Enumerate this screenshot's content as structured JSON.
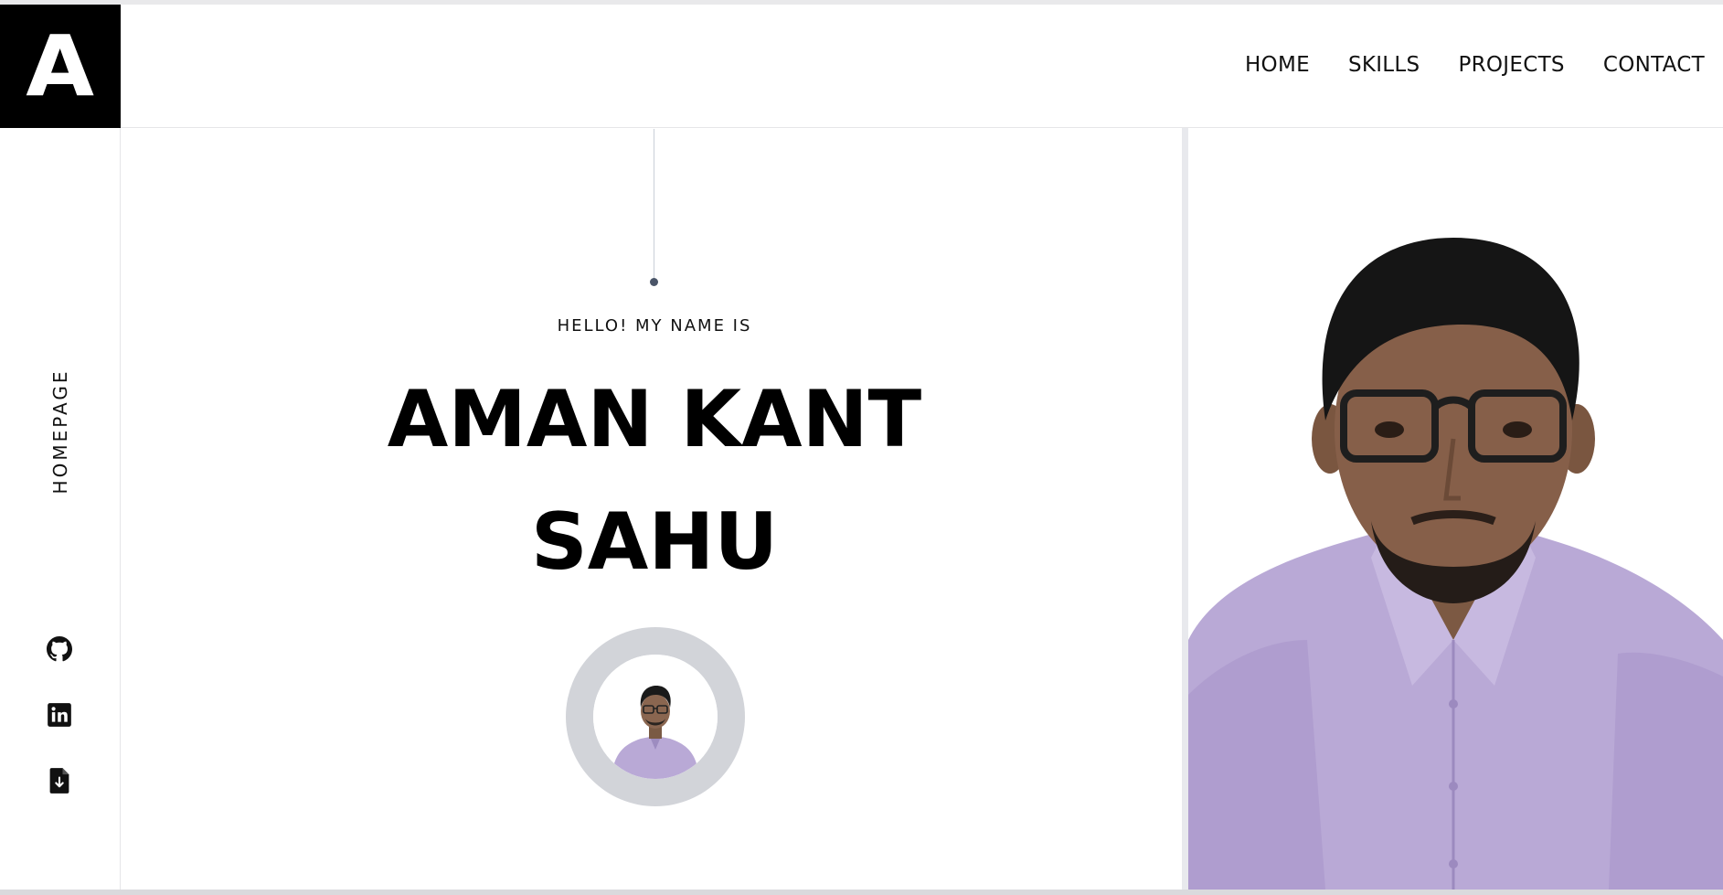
{
  "header": {
    "logo_text": "A",
    "nav": [
      "HOME",
      "SKILLS",
      "PROJECTS",
      "CONTACT"
    ]
  },
  "sidebar": {
    "label": "HOMEPAGE",
    "social": [
      {
        "name": "github",
        "icon": "github-icon"
      },
      {
        "name": "linkedin",
        "icon": "linkedin-icon"
      },
      {
        "name": "resume",
        "icon": "file-download-icon"
      }
    ]
  },
  "hero": {
    "greeting": "HELLO! MY NAME IS",
    "name_line1": "AMAN KANT",
    "name_line2": "SAHU"
  },
  "colors": {
    "logo_bg": "#000000",
    "text": "#111111",
    "avatar_ring": "#d2d4d9",
    "shirt": "#b9a9d6"
  }
}
